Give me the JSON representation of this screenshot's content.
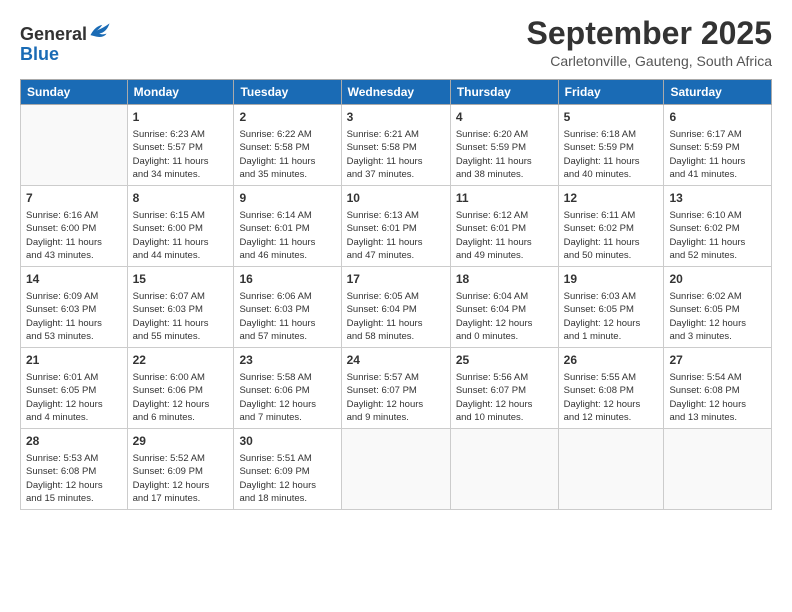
{
  "header": {
    "logo_line1": "General",
    "logo_line2": "Blue",
    "month_title": "September 2025",
    "location": "Carletonville, Gauteng, South Africa"
  },
  "weekdays": [
    "Sunday",
    "Monday",
    "Tuesday",
    "Wednesday",
    "Thursday",
    "Friday",
    "Saturday"
  ],
  "weeks": [
    [
      {
        "day": "",
        "content": ""
      },
      {
        "day": "1",
        "content": "Sunrise: 6:23 AM\nSunset: 5:57 PM\nDaylight: 11 hours\nand 34 minutes."
      },
      {
        "day": "2",
        "content": "Sunrise: 6:22 AM\nSunset: 5:58 PM\nDaylight: 11 hours\nand 35 minutes."
      },
      {
        "day": "3",
        "content": "Sunrise: 6:21 AM\nSunset: 5:58 PM\nDaylight: 11 hours\nand 37 minutes."
      },
      {
        "day": "4",
        "content": "Sunrise: 6:20 AM\nSunset: 5:59 PM\nDaylight: 11 hours\nand 38 minutes."
      },
      {
        "day": "5",
        "content": "Sunrise: 6:18 AM\nSunset: 5:59 PM\nDaylight: 11 hours\nand 40 minutes."
      },
      {
        "day": "6",
        "content": "Sunrise: 6:17 AM\nSunset: 5:59 PM\nDaylight: 11 hours\nand 41 minutes."
      }
    ],
    [
      {
        "day": "7",
        "content": "Sunrise: 6:16 AM\nSunset: 6:00 PM\nDaylight: 11 hours\nand 43 minutes."
      },
      {
        "day": "8",
        "content": "Sunrise: 6:15 AM\nSunset: 6:00 PM\nDaylight: 11 hours\nand 44 minutes."
      },
      {
        "day": "9",
        "content": "Sunrise: 6:14 AM\nSunset: 6:01 PM\nDaylight: 11 hours\nand 46 minutes."
      },
      {
        "day": "10",
        "content": "Sunrise: 6:13 AM\nSunset: 6:01 PM\nDaylight: 11 hours\nand 47 minutes."
      },
      {
        "day": "11",
        "content": "Sunrise: 6:12 AM\nSunset: 6:01 PM\nDaylight: 11 hours\nand 49 minutes."
      },
      {
        "day": "12",
        "content": "Sunrise: 6:11 AM\nSunset: 6:02 PM\nDaylight: 11 hours\nand 50 minutes."
      },
      {
        "day": "13",
        "content": "Sunrise: 6:10 AM\nSunset: 6:02 PM\nDaylight: 11 hours\nand 52 minutes."
      }
    ],
    [
      {
        "day": "14",
        "content": "Sunrise: 6:09 AM\nSunset: 6:03 PM\nDaylight: 11 hours\nand 53 minutes."
      },
      {
        "day": "15",
        "content": "Sunrise: 6:07 AM\nSunset: 6:03 PM\nDaylight: 11 hours\nand 55 minutes."
      },
      {
        "day": "16",
        "content": "Sunrise: 6:06 AM\nSunset: 6:03 PM\nDaylight: 11 hours\nand 57 minutes."
      },
      {
        "day": "17",
        "content": "Sunrise: 6:05 AM\nSunset: 6:04 PM\nDaylight: 11 hours\nand 58 minutes."
      },
      {
        "day": "18",
        "content": "Sunrise: 6:04 AM\nSunset: 6:04 PM\nDaylight: 12 hours\nand 0 minutes."
      },
      {
        "day": "19",
        "content": "Sunrise: 6:03 AM\nSunset: 6:05 PM\nDaylight: 12 hours\nand 1 minute."
      },
      {
        "day": "20",
        "content": "Sunrise: 6:02 AM\nSunset: 6:05 PM\nDaylight: 12 hours\nand 3 minutes."
      }
    ],
    [
      {
        "day": "21",
        "content": "Sunrise: 6:01 AM\nSunset: 6:05 PM\nDaylight: 12 hours\nand 4 minutes."
      },
      {
        "day": "22",
        "content": "Sunrise: 6:00 AM\nSunset: 6:06 PM\nDaylight: 12 hours\nand 6 minutes."
      },
      {
        "day": "23",
        "content": "Sunrise: 5:58 AM\nSunset: 6:06 PM\nDaylight: 12 hours\nand 7 minutes."
      },
      {
        "day": "24",
        "content": "Sunrise: 5:57 AM\nSunset: 6:07 PM\nDaylight: 12 hours\nand 9 minutes."
      },
      {
        "day": "25",
        "content": "Sunrise: 5:56 AM\nSunset: 6:07 PM\nDaylight: 12 hours\nand 10 minutes."
      },
      {
        "day": "26",
        "content": "Sunrise: 5:55 AM\nSunset: 6:08 PM\nDaylight: 12 hours\nand 12 minutes."
      },
      {
        "day": "27",
        "content": "Sunrise: 5:54 AM\nSunset: 6:08 PM\nDaylight: 12 hours\nand 13 minutes."
      }
    ],
    [
      {
        "day": "28",
        "content": "Sunrise: 5:53 AM\nSunset: 6:08 PM\nDaylight: 12 hours\nand 15 minutes."
      },
      {
        "day": "29",
        "content": "Sunrise: 5:52 AM\nSunset: 6:09 PM\nDaylight: 12 hours\nand 17 minutes."
      },
      {
        "day": "30",
        "content": "Sunrise: 5:51 AM\nSunset: 6:09 PM\nDaylight: 12 hours\nand 18 minutes."
      },
      {
        "day": "",
        "content": ""
      },
      {
        "day": "",
        "content": ""
      },
      {
        "day": "",
        "content": ""
      },
      {
        "day": "",
        "content": ""
      }
    ]
  ]
}
